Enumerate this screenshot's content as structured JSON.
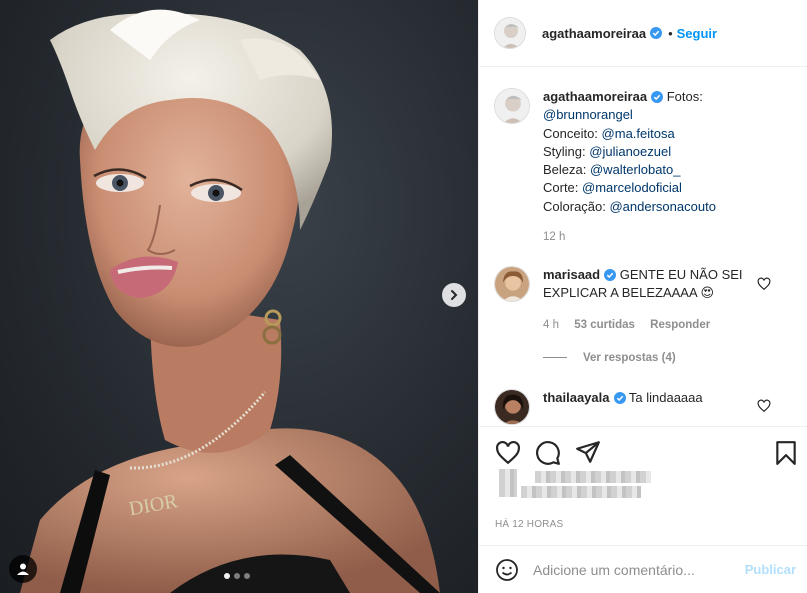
{
  "post": {
    "author": "agathaamoreiraa",
    "separator": "•",
    "follow_label": "Seguir",
    "images_count": 3,
    "active_image": 1
  },
  "caption": {
    "author": "agathaamoreiraa",
    "lines": [
      {
        "prefix": "Fotos:",
        "handle": ""
      },
      {
        "prefix": "",
        "handle": "@brunnorangel"
      },
      {
        "prefix": "Conceito: ",
        "handle": "@ma.feitosa"
      },
      {
        "prefix": "Styling: ",
        "handle": "@julianoezuel"
      },
      {
        "prefix": "Beleza: ",
        "handle": "@walterlobato_"
      },
      {
        "prefix": "Corte: ",
        "handle": "@marcelodoficial"
      },
      {
        "prefix": "Coloração: ",
        "handle": "@andersonacouto"
      }
    ],
    "time": "12 h"
  },
  "comments": [
    {
      "author": "marisaad",
      "text": "GENTE EU NÃO SEI EXPLICAR A BELEZAAAA 😍",
      "time": "4 h",
      "likes": "53 curtidas",
      "reply": "Responder",
      "view_replies": "Ver respostas (4)"
    },
    {
      "author": "thailaayala",
      "text": "Ta lindaaaaa"
    }
  ],
  "footer": {
    "timestamp": "HÁ 12 HORAS",
    "comment_placeholder": "Adicione um comentário...",
    "publish_label": "Publicar"
  },
  "colors": {
    "accent": "#0095f6",
    "verified": "#3897f0",
    "link": "#00376b",
    "muted": "#8e8e8e"
  }
}
